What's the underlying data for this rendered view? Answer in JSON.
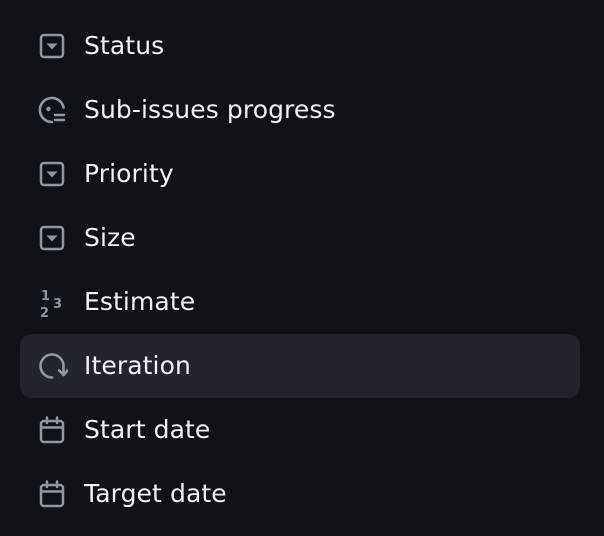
{
  "menu": {
    "items": [
      {
        "label": "Status",
        "icon": "single-select-icon"
      },
      {
        "label": "Sub-issues progress",
        "icon": "progress-icon"
      },
      {
        "label": "Priority",
        "icon": "single-select-icon"
      },
      {
        "label": "Size",
        "icon": "single-select-icon"
      },
      {
        "label": "Estimate",
        "icon": "number-icon"
      },
      {
        "label": "Iteration",
        "icon": "iteration-icon",
        "active": true
      },
      {
        "label": "Start date",
        "icon": "calendar-icon"
      },
      {
        "label": "Target date",
        "icon": "calendar-icon"
      }
    ]
  },
  "colors": {
    "background": "#0f1216",
    "active_background": "#22262c",
    "text": "#f0f3f6",
    "icon": "#9198a1"
  }
}
